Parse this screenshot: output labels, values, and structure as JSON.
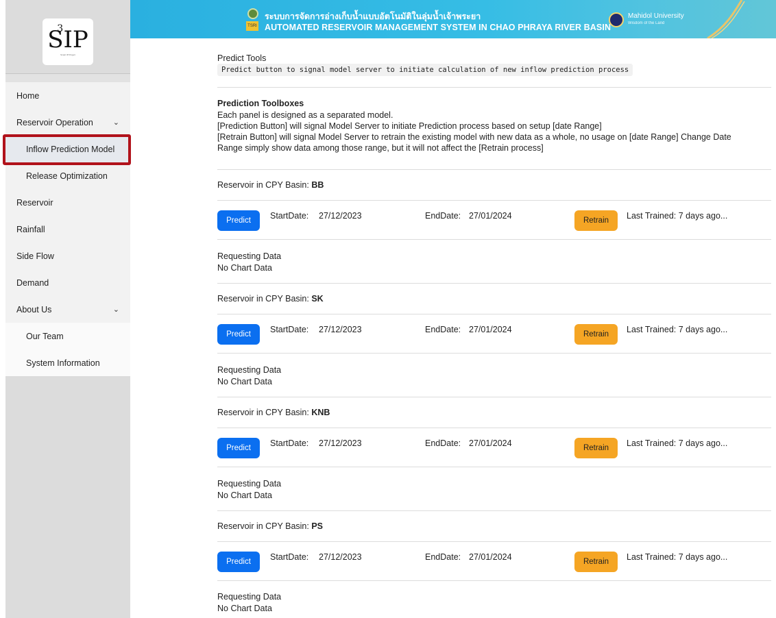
{
  "sidebar": {
    "logo": {
      "main": "SIP",
      "sup": "3",
      "sub": "Smart IP Project"
    },
    "items": [
      {
        "label": "Home"
      },
      {
        "label": "Reservoir Operation",
        "chevron": "⌄"
      },
      {
        "label": "Inflow Prediction Model"
      },
      {
        "label": "Release Optimization"
      },
      {
        "label": "Reservoir"
      },
      {
        "label": "Rainfall"
      },
      {
        "label": "Side Flow"
      },
      {
        "label": "Demand"
      },
      {
        "label": "About Us",
        "chevron": "⌄"
      },
      {
        "label": "Our Team"
      },
      {
        "label": "System Information"
      }
    ]
  },
  "banner": {
    "title_th": "ระบบการจัดการอ่างเก็บน้ำแบบอัตโนมัติในลุ่มน้ำเจ้าพระยา",
    "title_en": "AUTOMATED RESERVOIR MANAGEMENT SYSTEM IN CHAO PHRAYA RIVER BASIN",
    "tsri_label": "TSRI",
    "university": "Mahidol University",
    "university_sub": "Wisdom of the Land"
  },
  "tools": {
    "title": "Predict Tools",
    "code": "Predict button to signal model server to initiate calculation of new inflow prediction process"
  },
  "toolboxes": {
    "title": "Prediction Toolboxes",
    "line1": "Each panel is designed as a separated model.",
    "line2": "[Prediction Button] will signal Model Server to initiate Prediction process based on setup [date Range]",
    "line3": "[Retrain Button] will signal Model Server to retrain the existing model with new data as a whole, no usage on [date Range] Change Date",
    "line4": "Range simply show data among those range, but it will not affect the [Retrain process]"
  },
  "common": {
    "reservoir_prefix": "Reservoir in CPY Basin: ",
    "predict_label": "Predict",
    "start_label": "StartDate:",
    "end_label": "EndDate:",
    "retrain_label": "Retrain",
    "requesting": "Requesting Data",
    "no_chart": "No Chart Data"
  },
  "reservoirs": [
    {
      "code": "BB",
      "start": "27/12/2023",
      "end": "27/01/2024",
      "trained": "Last Trained: 7 days ago..."
    },
    {
      "code": "SK",
      "start": "27/12/2023",
      "end": "27/01/2024",
      "trained": "Last Trained: 7 days ago..."
    },
    {
      "code": "KNB",
      "start": "27/12/2023",
      "end": "27/01/2024",
      "trained": "Last Trained: 7 days ago..."
    },
    {
      "code": "PS",
      "start": "27/12/2023",
      "end": "27/01/2024",
      "trained": "Last Trained: 7 days ago..."
    }
  ],
  "colors": {
    "predict": "#0b6ff0",
    "retrain": "#f5a524",
    "highlight": "#b1121b",
    "banner": "#36bde5"
  }
}
